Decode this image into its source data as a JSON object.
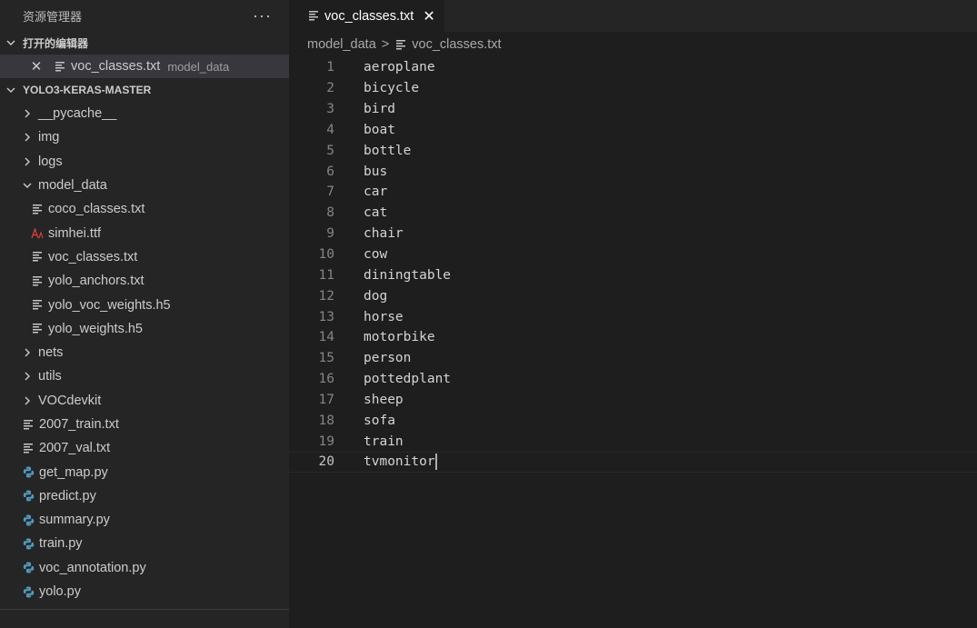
{
  "sidebar": {
    "title": "资源管理器",
    "more_glyph": "···",
    "open_editors": {
      "header": "打开的编辑器",
      "items": [
        {
          "close_glyph": "✕",
          "name": "voc_classes.txt",
          "desc": "model_data"
        }
      ]
    },
    "project": {
      "header": "YOLO3-KERAS-MASTER",
      "tree": [
        {
          "name": "__pycache__",
          "kind": "folder",
          "open": false
        },
        {
          "name": "img",
          "kind": "folder",
          "open": false
        },
        {
          "name": "logs",
          "kind": "folder",
          "open": false
        },
        {
          "name": "model_data",
          "kind": "folder",
          "open": true
        },
        {
          "name": "coco_classes.txt",
          "kind": "txt",
          "child": true
        },
        {
          "name": "simhei.ttf",
          "kind": "font",
          "child": true
        },
        {
          "name": "voc_classes.txt",
          "kind": "txt",
          "child": true
        },
        {
          "name": "yolo_anchors.txt",
          "kind": "txt",
          "child": true
        },
        {
          "name": "yolo_voc_weights.h5",
          "kind": "txt",
          "child": true
        },
        {
          "name": "yolo_weights.h5",
          "kind": "txt",
          "child": true
        },
        {
          "name": "nets",
          "kind": "folder",
          "open": false
        },
        {
          "name": "utils",
          "kind": "folder",
          "open": false
        },
        {
          "name": "VOCdevkit",
          "kind": "folder",
          "open": false
        },
        {
          "name": "2007_train.txt",
          "kind": "txt"
        },
        {
          "name": "2007_val.txt",
          "kind": "txt"
        },
        {
          "name": "get_map.py",
          "kind": "py"
        },
        {
          "name": "predict.py",
          "kind": "py"
        },
        {
          "name": "summary.py",
          "kind": "py"
        },
        {
          "name": "train.py",
          "kind": "py"
        },
        {
          "name": "voc_annotation.py",
          "kind": "py"
        },
        {
          "name": "yolo.py",
          "kind": "py"
        }
      ]
    }
  },
  "editor": {
    "tab": {
      "label": "voc_classes.txt",
      "close_glyph": "✕"
    },
    "breadcrumb": {
      "folder": "model_data",
      "separator": ">",
      "file": "voc_classes.txt"
    },
    "current_line": 20,
    "lines": [
      "aeroplane",
      "bicycle",
      "bird",
      "boat",
      "bottle",
      "bus",
      "car",
      "cat",
      "chair",
      "cow",
      "diningtable",
      "dog",
      "horse",
      "motorbike",
      "person",
      "pottedplant",
      "sheep",
      "sofa",
      "train",
      "tvmonitor"
    ]
  },
  "colors": {
    "python_icon": "#519aba",
    "font_icon": "#e04040",
    "sidebar_bg": "#252526",
    "editor_bg": "#1e1e1e"
  }
}
